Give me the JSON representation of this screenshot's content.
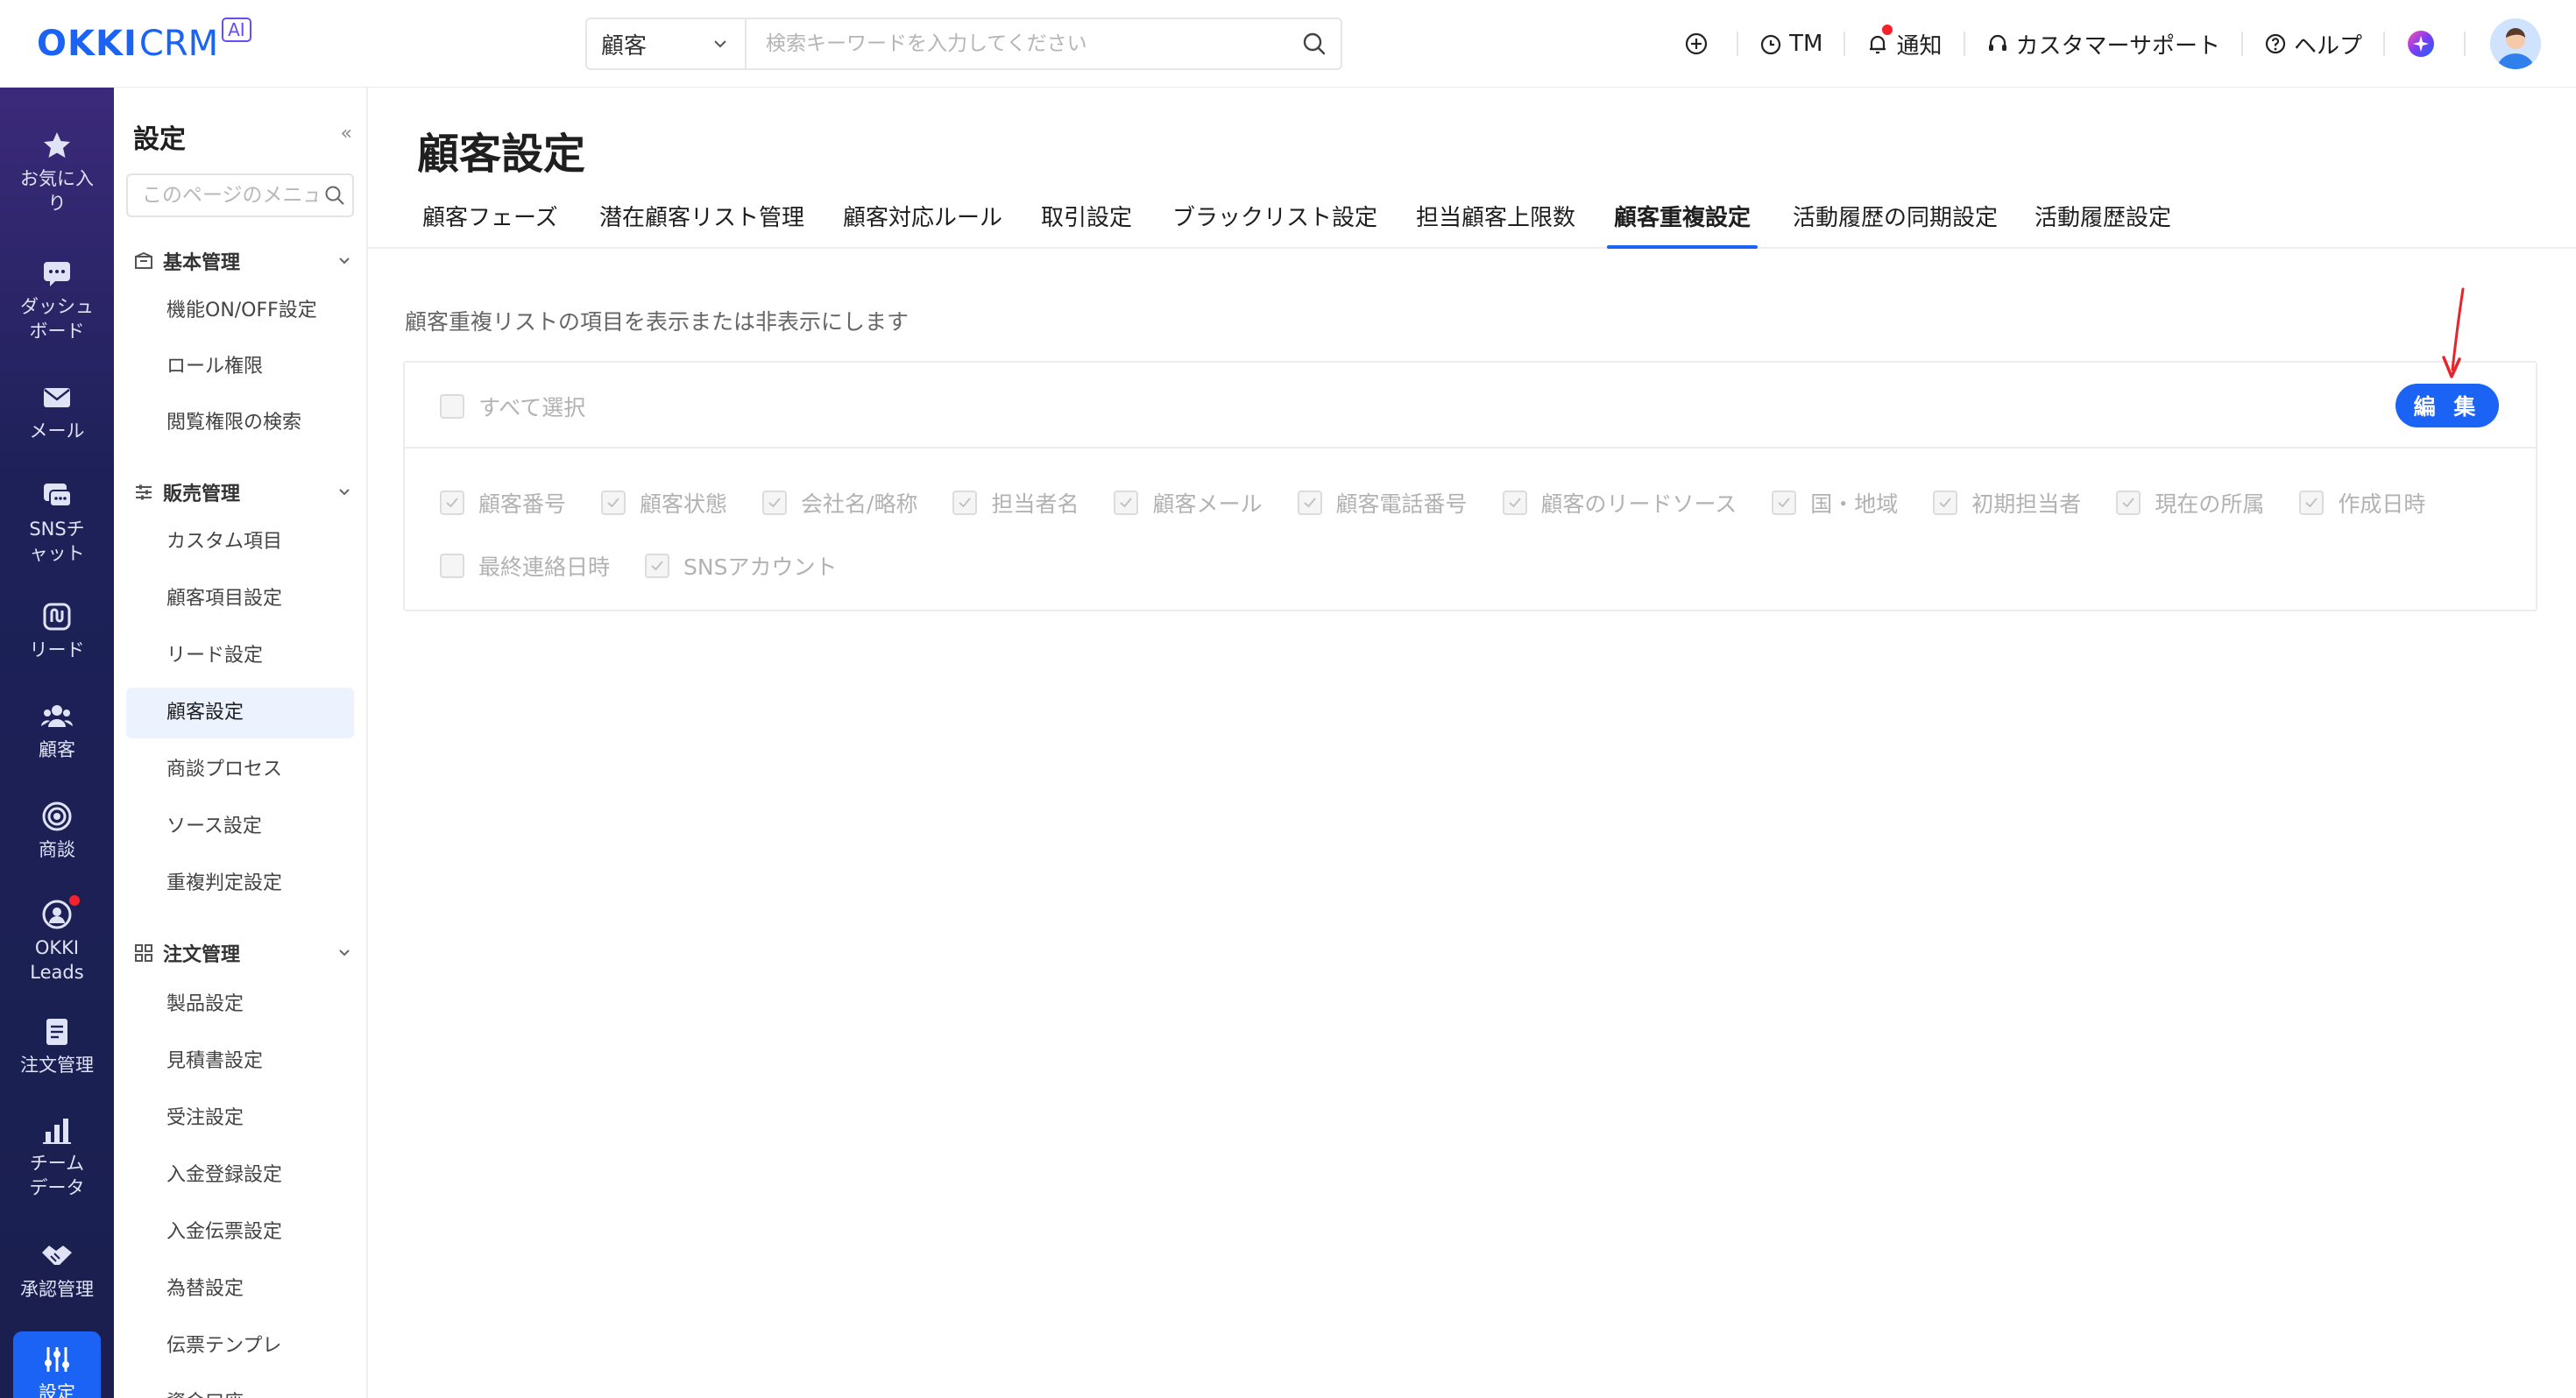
{
  "header": {
    "logo_main": "OKKI",
    "logo_sub": "CRM",
    "logo_badge": "AI",
    "search_scope": "顧客",
    "search_placeholder": "検索キーワードを入力してください",
    "actions": {
      "tm": "TM",
      "notify": "通知",
      "support": "カスタマーサポート",
      "help": "ヘルプ"
    }
  },
  "leftnav": {
    "items": [
      {
        "label": "お気に入り",
        "icon": "star-icon"
      },
      {
        "label": "ダッシュボード",
        "icon": "dashboard-icon"
      },
      {
        "label": "メール",
        "icon": "mail-icon"
      },
      {
        "label": "SNSチャット",
        "icon": "chat-icon"
      },
      {
        "label": "リード",
        "icon": "lead-icon"
      },
      {
        "label": "顧客",
        "icon": "customers-icon"
      },
      {
        "label": "商談",
        "icon": "target-icon"
      },
      {
        "label": "OKKI Leads",
        "icon": "leads-icon"
      },
      {
        "label": "注文管理",
        "icon": "order-icon"
      },
      {
        "label": "チームデータ",
        "icon": "chart-icon"
      },
      {
        "label": "承認管理",
        "icon": "handshake-icon"
      },
      {
        "label": "設定",
        "icon": "settings-icon"
      }
    ]
  },
  "sidebar": {
    "title": "設定",
    "collapse": "«",
    "search_placeholder": "このページのメニューを検索",
    "groups": [
      {
        "label": "基本管理",
        "items": [
          "機能ON/OFF設定",
          "ロール権限",
          "閲覧権限の検索"
        ]
      },
      {
        "label": "販売管理",
        "items": [
          "カスタム項目",
          "顧客項目設定",
          "リード設定",
          "顧客設定",
          "商談プロセス",
          "ソース設定",
          "重複判定設定"
        ]
      },
      {
        "label": "注文管理",
        "items": [
          "製品設定",
          "見積書設定",
          "受注設定",
          "入金登録設定",
          "入金伝票設定",
          "為替設定",
          "伝票テンプレ",
          "資金口座"
        ]
      }
    ],
    "active": "顧客設定"
  },
  "main": {
    "title": "顧客設定",
    "tabs": [
      "顧客フェーズ",
      "潜在顧客リスト管理",
      "顧客対応ルール",
      "取引設定",
      "ブラックリスト設定",
      "担当顧客上限数",
      "顧客重複設定",
      "活動履歴の同期設定",
      "活動履歴設定"
    ],
    "active_tab": "顧客重複設定",
    "description": "顧客重複リストの項目を表示または非表示にします",
    "select_all": "すべて選択",
    "edit_button": "編 集",
    "fields_row1": [
      {
        "label": "顧客番号",
        "checked": true
      },
      {
        "label": "顧客状態",
        "checked": true
      },
      {
        "label": "会社名/略称",
        "checked": true
      },
      {
        "label": "担当者名",
        "checked": true
      },
      {
        "label": "顧客メール",
        "checked": true
      },
      {
        "label": "顧客電話番号",
        "checked": true
      },
      {
        "label": "顧客のリードソース",
        "checked": true
      },
      {
        "label": "国・地域",
        "checked": true
      },
      {
        "label": "初期担当者",
        "checked": true
      },
      {
        "label": "現在の所属",
        "checked": true
      },
      {
        "label": "作成日時",
        "checked": true
      }
    ],
    "fields_row2": [
      {
        "label": "最終連絡日時",
        "checked": false
      },
      {
        "label": "SNSアカウント",
        "checked": true
      }
    ]
  },
  "colors": {
    "brand": "#1a63f5",
    "nav_bg": "#1a1f4f",
    "active_bg": "#ecf3ff",
    "annotation_arrow": "#e8232a"
  }
}
